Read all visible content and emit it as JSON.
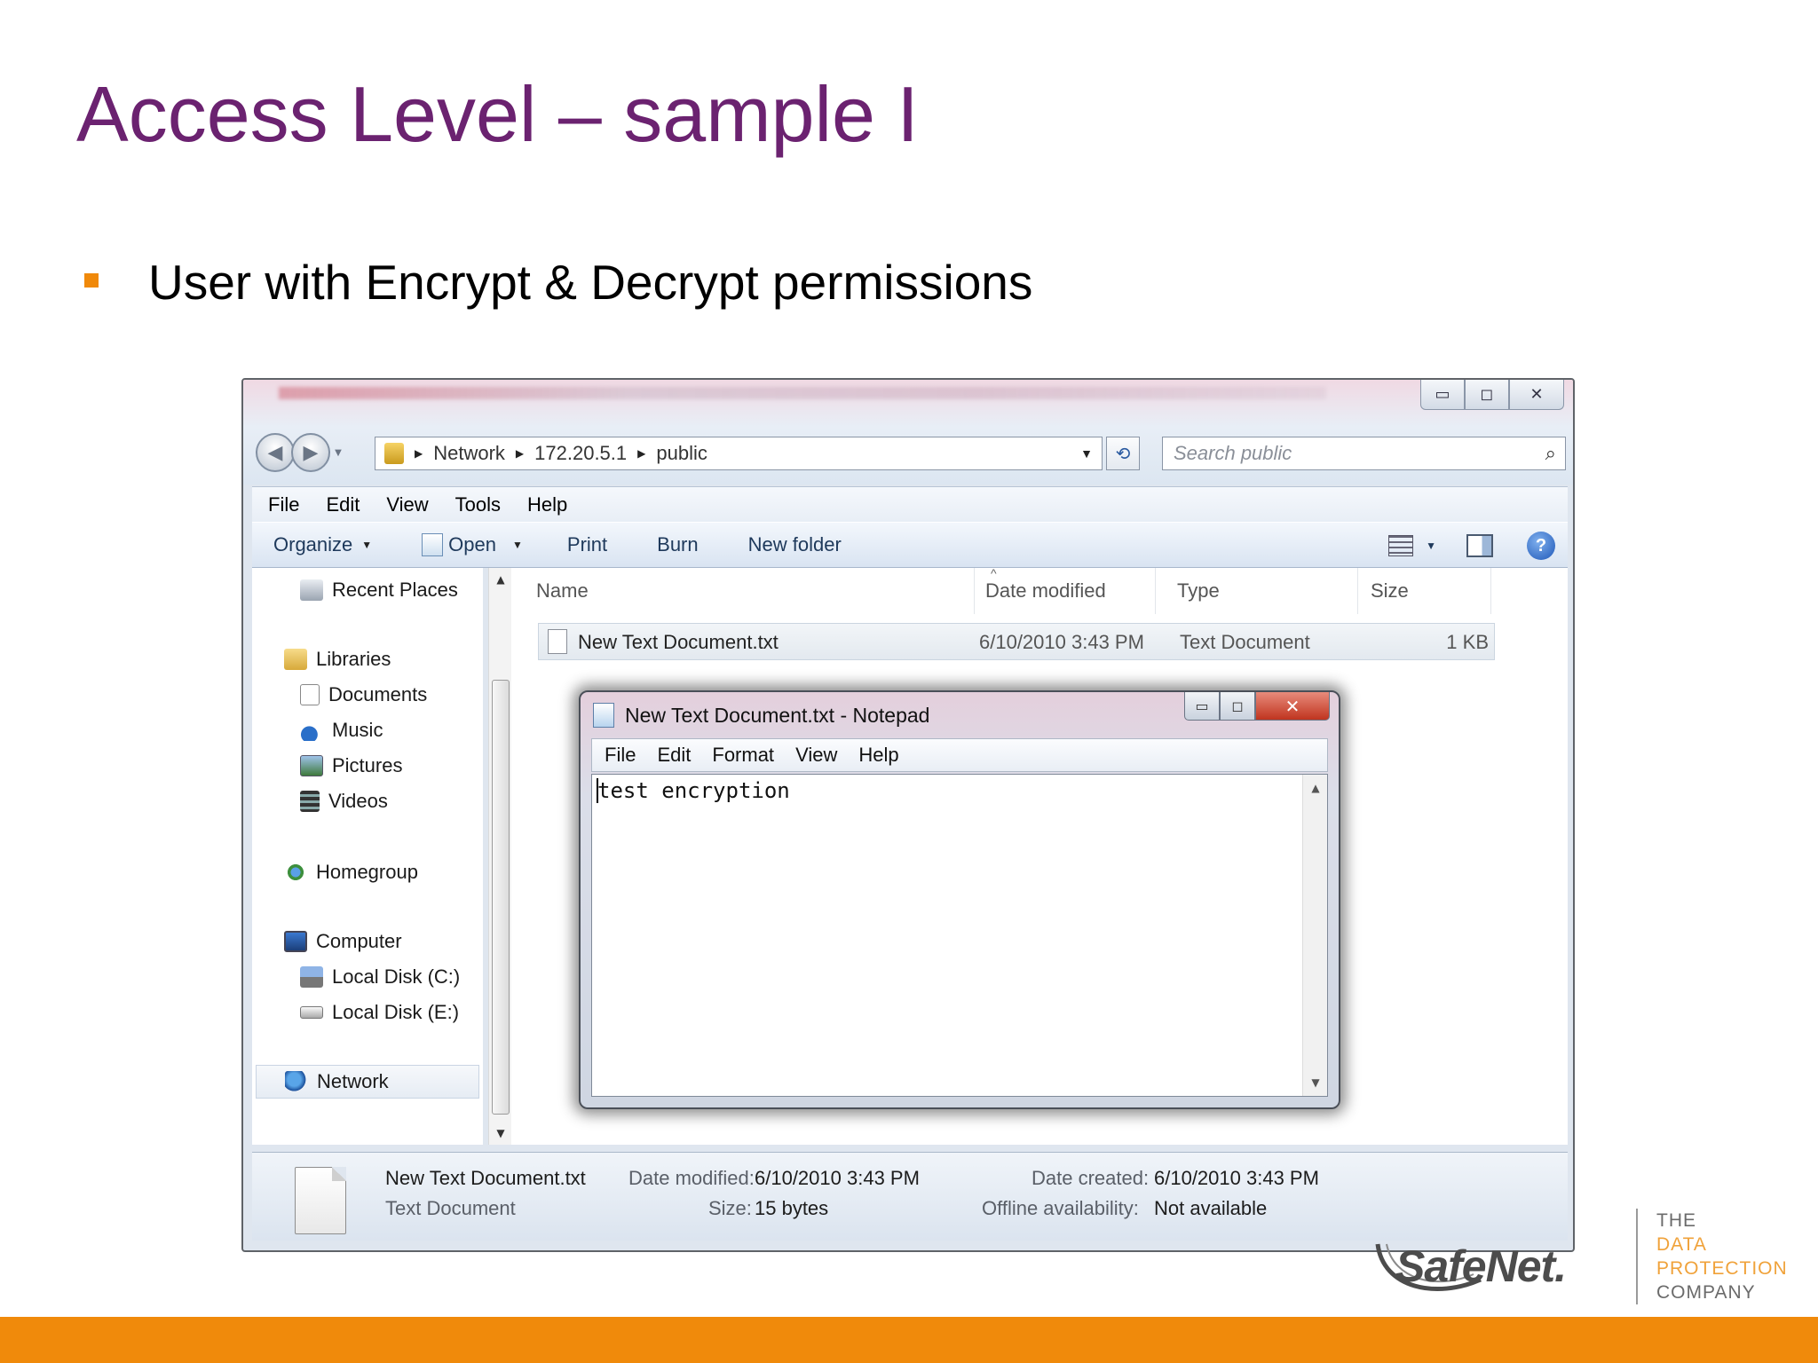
{
  "slide": {
    "title": "Access Level – sample I",
    "bullet": "User with Encrypt & Decrypt permissions"
  },
  "explorer": {
    "window_buttons": [
      "▭",
      "◻",
      "✕"
    ],
    "breadcrumbs": [
      "Network",
      "172.20.5.1",
      "public"
    ],
    "search_placeholder": "Search public",
    "menu": [
      "File",
      "Edit",
      "View",
      "Tools",
      "Help"
    ],
    "commands": {
      "organize": "Organize",
      "open": "Open",
      "print": "Print",
      "burn": "Burn",
      "new_folder": "New folder"
    },
    "nav": {
      "recent_places": "Recent Places",
      "libraries": "Libraries",
      "documents": "Documents",
      "music": "Music",
      "pictures": "Pictures",
      "videos": "Videos",
      "homegroup": "Homegroup",
      "computer": "Computer",
      "local_disk_c": "Local Disk (C:)",
      "local_disk_e": "Local Disk (E:)",
      "network": "Network"
    },
    "columns": {
      "name": "Name",
      "date_modified": "Date modified",
      "type": "Type",
      "size": "Size"
    },
    "files": [
      {
        "name": "New Text Document.txt",
        "date_modified": "6/10/2010 3:43 PM",
        "type": "Text Document",
        "size": "1 KB"
      }
    ],
    "details": {
      "name": "New Text Document.txt",
      "type": "Text Document",
      "date_modified_label": "Date modified:",
      "date_modified": "6/10/2010 3:43 PM",
      "size_label": "Size:",
      "size": "15 bytes",
      "date_created_label": "Date created:",
      "date_created": "6/10/2010 3:43 PM",
      "offline_label": "Offline availability:",
      "offline": "Not available"
    }
  },
  "notepad": {
    "title": "New Text Document.txt - Notepad",
    "menu": [
      "File",
      "Edit",
      "Format",
      "View",
      "Help"
    ],
    "content": "test encryption"
  },
  "branding": {
    "logo": "SafeNet.",
    "tagline": [
      "THE",
      "DATA",
      "PROTECTION",
      "COMPANY"
    ],
    "colors": {
      "title": "#6b2270",
      "accent": "#f08a0b"
    }
  }
}
